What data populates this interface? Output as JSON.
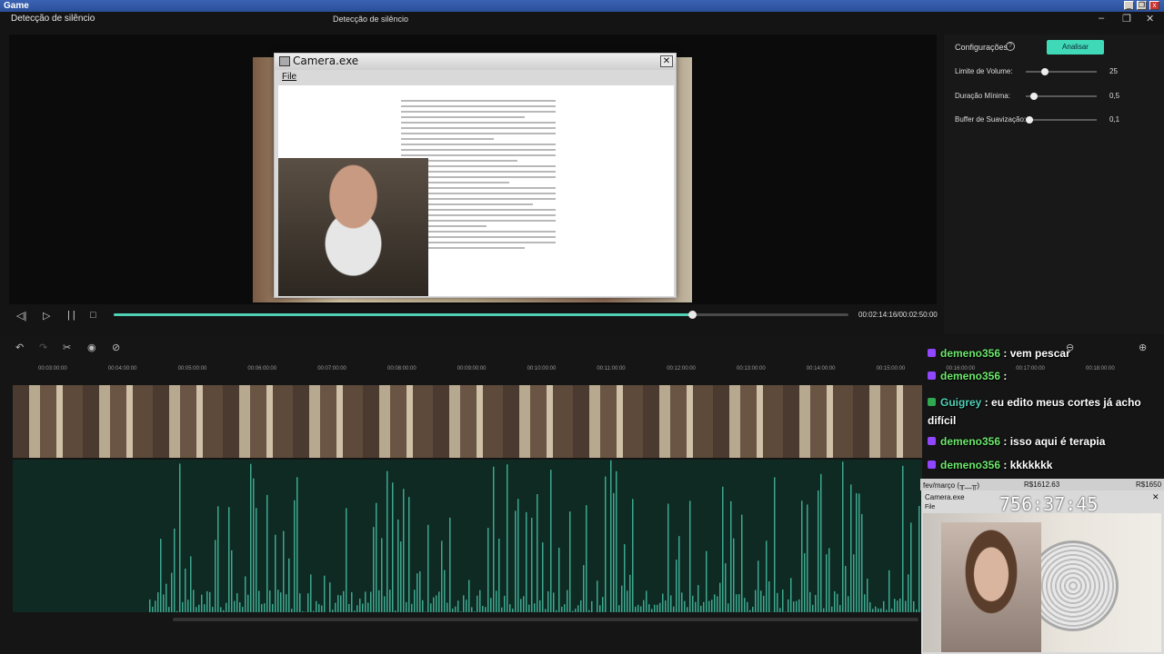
{
  "game_window": {
    "title": "Game",
    "buttons": [
      "_",
      "❐",
      "x"
    ]
  },
  "app": {
    "title": "Detecção de silêncio",
    "center_title": "Detecção de silêncio"
  },
  "camera_window": {
    "title": "Camera.exe",
    "menu": "File"
  },
  "transport": {
    "time": "00:02:14:16/00:02:50:00",
    "progress": 0.787
  },
  "settings": {
    "label": "Configurações",
    "analyze": "Analisar",
    "sliders": [
      {
        "label": "Limite de Volume:",
        "value": "25",
        "level": 0.27
      },
      {
        "label": "Duração Mínima:",
        "value": "0,5",
        "level": 0.11
      },
      {
        "label": "Buffer de Suavização:",
        "value": "0,1",
        "level": 0.05
      }
    ]
  },
  "ruler": [
    "00:03:00:00",
    "00:04:00:00",
    "00:05:00:00",
    "00:06:00:00",
    "00:07:00:00",
    "00:08:00:00",
    "00:09:00:00",
    "00:10:00:00",
    "00:11:00:00",
    "00:12:00:00",
    "00:13:00:00",
    "00:14:00:00",
    "00:15:00:00",
    "00:16:00:00",
    "00:17:00:00",
    "00:18:00:00"
  ],
  "chat": [
    {
      "user": "demeno356",
      "text": " : vem pescar"
    },
    {
      "user": "demeno356",
      "text": " : "
    },
    {
      "user": "Guigrey",
      "text": " : eu edito meus cortes já acho difícil"
    },
    {
      "user": "demeno356",
      "text": " : isso aqui é terapia"
    },
    {
      "user": "demeno356",
      "text": " : kkkkkkk"
    }
  ],
  "webcam": {
    "bar_left": "fev/março (╥﹏╥)",
    "bar_mid": "R$1612.63",
    "bar_right": "R$1650",
    "title": "Camera.exe",
    "menu": "File",
    "clock": "756:37:45"
  },
  "colors": {
    "accent": "#3fd9b8",
    "progress": "#4fd1b6"
  }
}
